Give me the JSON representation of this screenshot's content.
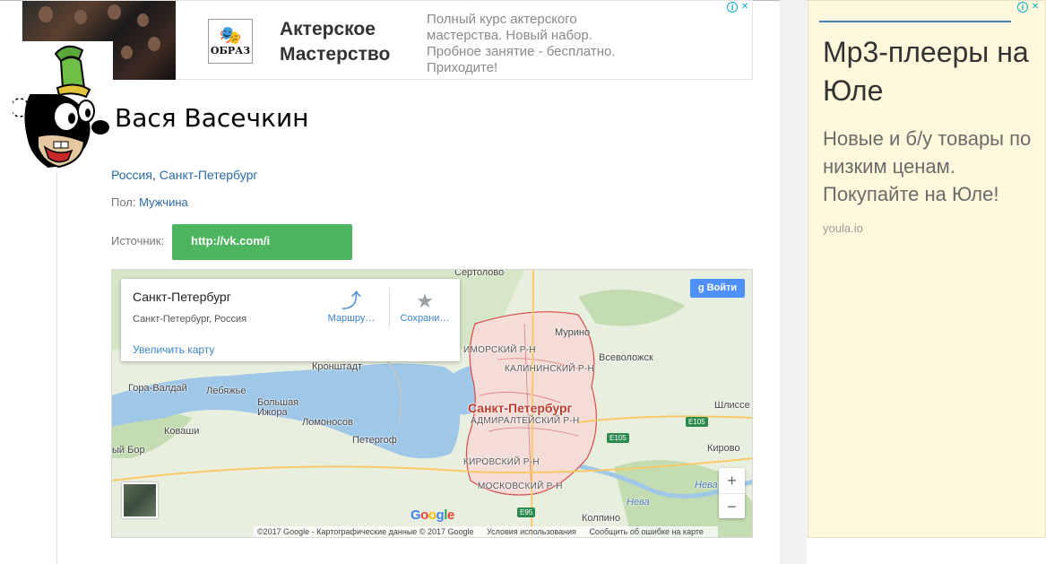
{
  "top_ad": {
    "logo_text": "ОБРАЗ",
    "title": "Актерское Мастерство",
    "description": "Полный курс актерского мастерства. Новый набор. Пробное занятие - бесплатно. Приходите!",
    "info_icon": "i",
    "close_icon": "✕"
  },
  "profile": {
    "name": "Вася Васечкин",
    "country": "Россия",
    "separator": ", ",
    "city": "Санкт-Петербург",
    "gender_label": "Пол:",
    "gender_value": "Мужчина",
    "source_label": "Источник:",
    "source_link": "http://vk.com/i"
  },
  "map": {
    "card": {
      "title": "Санкт-Петербург",
      "subtitle": "Санкт-Петербург, Россия",
      "zoom_link": "Увеличить карту",
      "route_label": "Маршру…",
      "save_label": "Сохрани…"
    },
    "signin_label": "Войти",
    "zoom_in": "+",
    "zoom_out": "−",
    "labels": {
      "sertolovo": "Сертолово",
      "murino": "Мурино",
      "primorsky": "ИМОРСКИЙ Р-Н",
      "kalininsky": "КАЛИНИНСКИЙ Р-Н",
      "kronshtadt": "Кронштадт",
      "vsevolozhsk": "Всеволожск",
      "gora_valday": "Гора-Валдай",
      "lebyazhye": "Лебяжье",
      "city": "Санкт-Петербург",
      "admiralteysky": "АДМИРАЛТЕЙСКИЙ Р-Н",
      "bolshaya_izhora": "Большая\nИжора",
      "lomonosov": "Ломоносов",
      "kovashi": "Коваши",
      "peterhof": "Петергоф",
      "maly_bor": "ый Бор",
      "kirovsky": "КИРОВСКИЙ Р-Н",
      "moskovsky": "МОСКОВСКИЙ Р-Н",
      "kolpino": "Колпино",
      "shlisselburg": "Шлиссе",
      "kirovsk": "Кирово",
      "neva": "Нева",
      "neva2": "Нева"
    },
    "shields": {
      "e105a": "E105",
      "e105b": "E105",
      "e95": "E95"
    },
    "google": [
      "G",
      "o",
      "o",
      "g",
      "l",
      "e"
    ],
    "attribution": {
      "copyright": "©2017 Google - Картографические данные © 2017 Google",
      "terms": "Условия использования",
      "report": "Сообщить об ошибке на карте"
    }
  },
  "right_ad": {
    "headline": "Mp3-плееры на Юле",
    "body": "Новые и б/у товары по низким ценам. Покупайте на Юле!",
    "domain": "youla.io"
  }
}
